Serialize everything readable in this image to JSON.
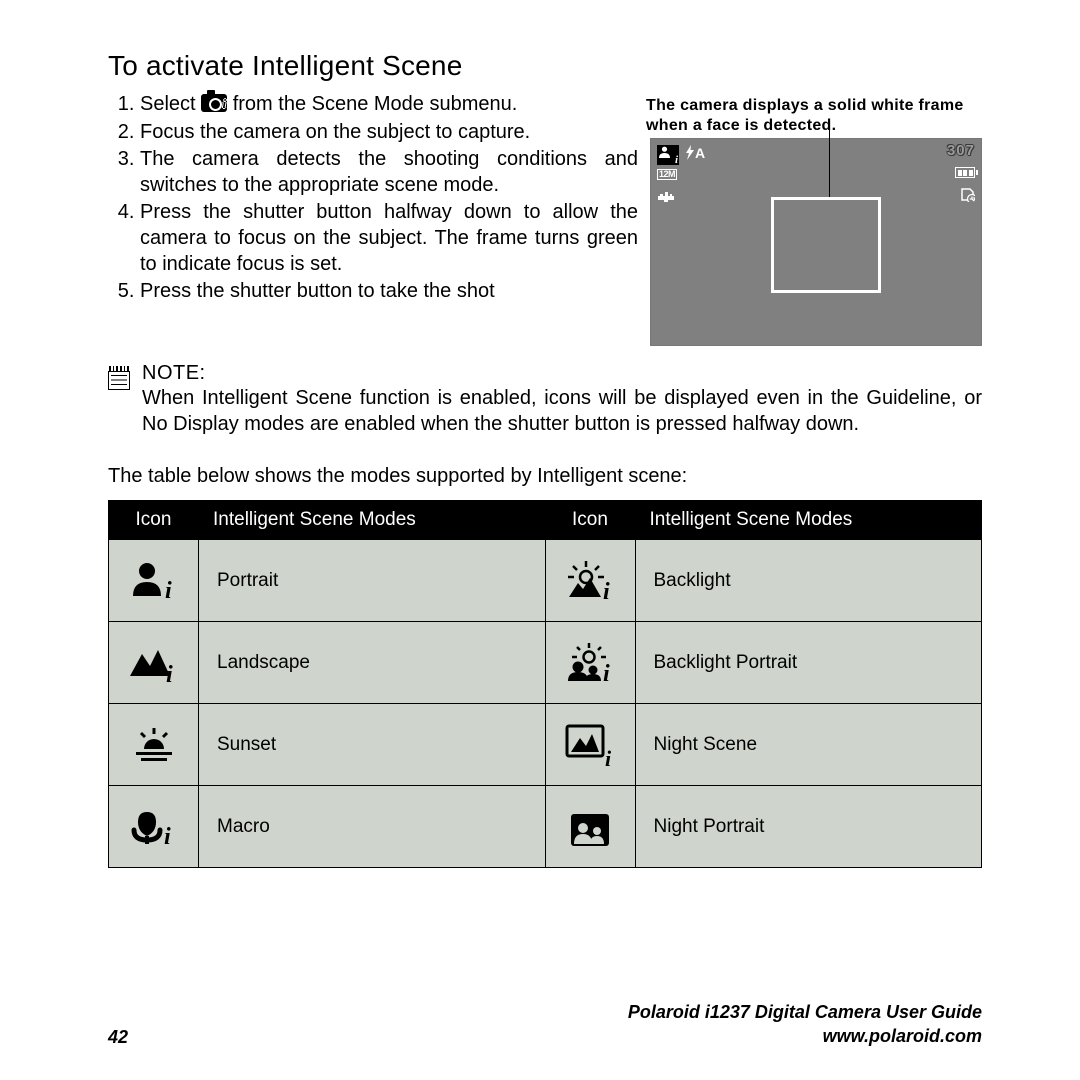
{
  "title": "To activate Intelligent Scene",
  "steps": {
    "s1a": "Select ",
    "s1b": " from the Scene Mode submenu.",
    "s2": "Focus the camera on the subject to capture.",
    "s3": "The camera detects the shooting conditions and switches to the appropriate scene mode.",
    "s4": "Press the shutter button halfway down to allow the camera to focus on the subject. The frame turns green to indicate focus is set.",
    "s5": "Press the shutter button to take the shot"
  },
  "caption": "The camera displays a solid white frame when a face is detected.",
  "screen": {
    "flash_auto": "A",
    "resolution": "12M",
    "shots_remaining": "307"
  },
  "note": {
    "label": "NOTE:",
    "text": "When Intelligent Scene function is enabled, icons will be displayed even in the Guideline, or No Display modes are enabled when the shutter button is pressed halfway down."
  },
  "table_intro": "The table below shows the modes supported by Intelligent scene:",
  "table": {
    "head_icon": "Icon",
    "head_mode": "Intelligent Scene Modes",
    "rows": [
      {
        "left": "Portrait",
        "right": "Backlight"
      },
      {
        "left": "Landscape",
        "right": "Backlight Portrait"
      },
      {
        "left": "Sunset",
        "right": "Night Scene"
      },
      {
        "left": "Macro",
        "right": "Night Portrait"
      }
    ]
  },
  "footer": {
    "page": "42",
    "guide": "Polaroid i1237 Digital Camera User Guide",
    "url": "www.polaroid.com"
  }
}
